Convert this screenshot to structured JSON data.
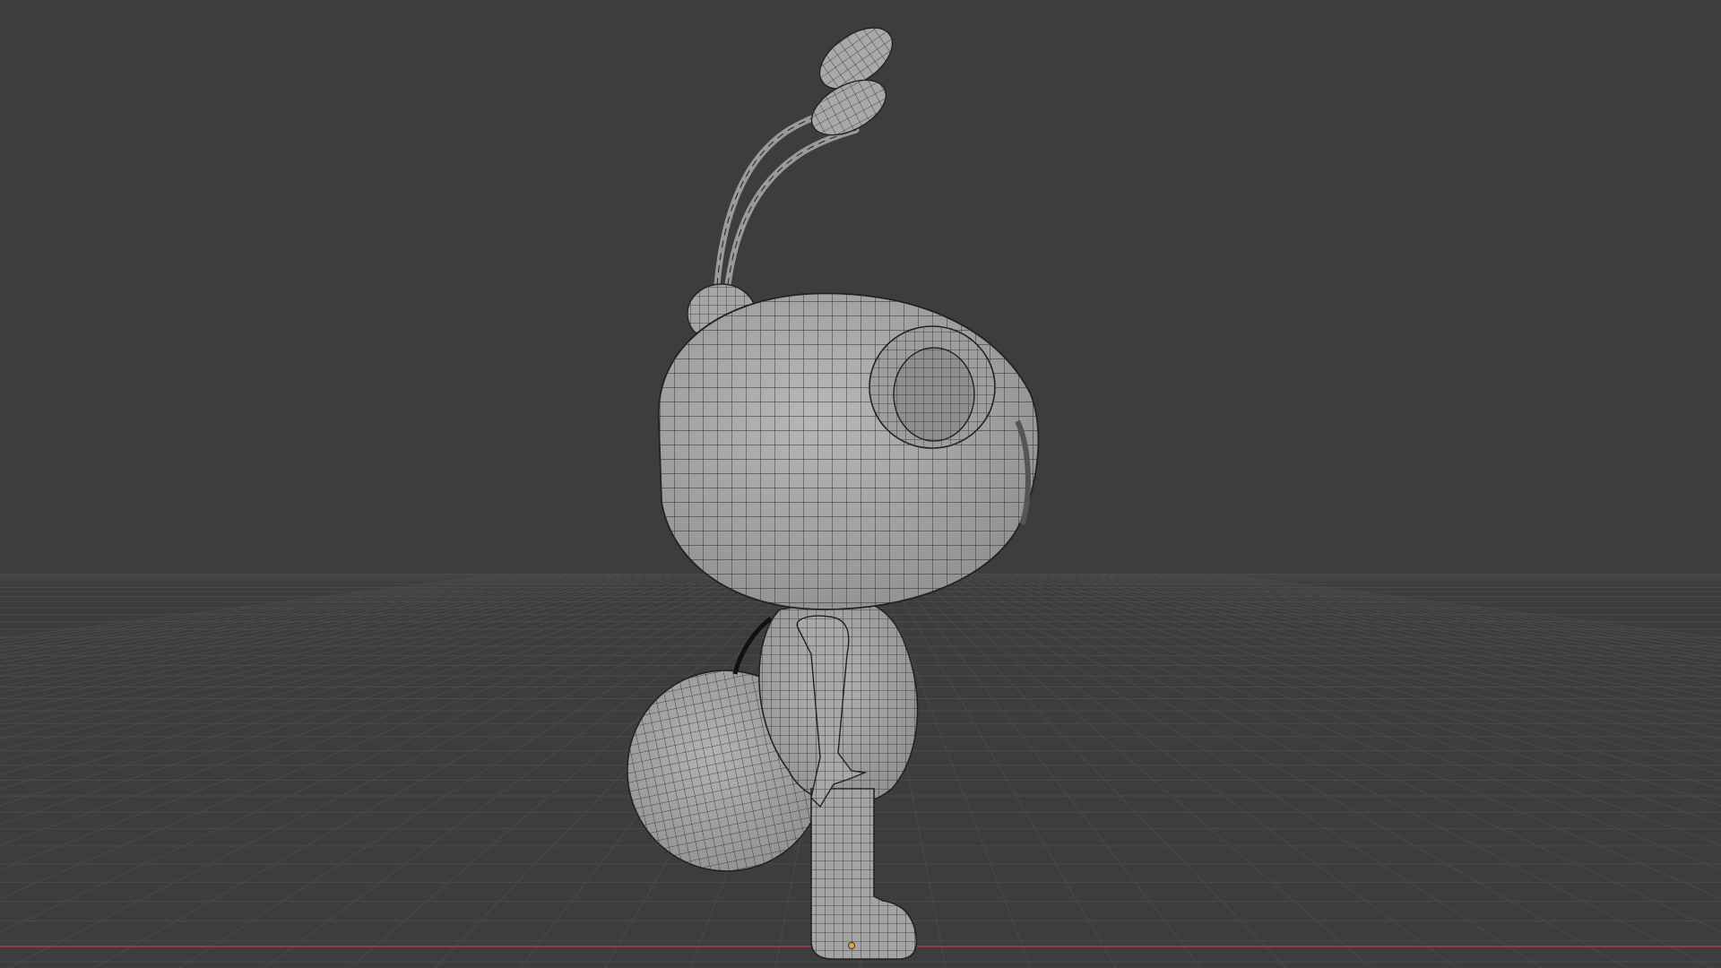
{
  "viewport": {
    "background": "#3d3d3d",
    "grid_line_color": "#4a4a4a",
    "x_axis_color": "#8e3b47",
    "mesh_fill": "#a9a9a9",
    "mesh_wire": "#222222",
    "origin_color": "#e8a532"
  },
  "model": {
    "icon": "bee-character-wireframe",
    "shading": "solid-with-wireframe"
  }
}
